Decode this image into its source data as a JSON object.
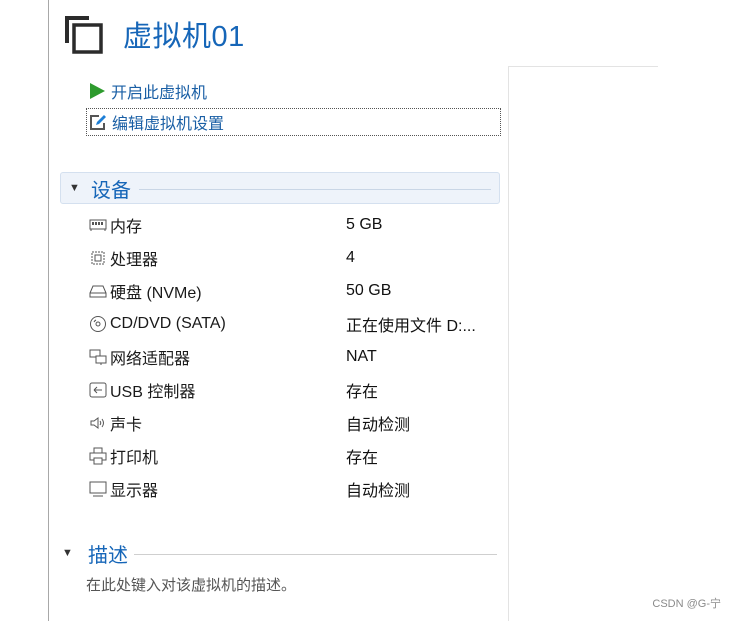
{
  "vm": {
    "title": "虚拟机01"
  },
  "actions": {
    "start_label": "开启此虚拟机",
    "edit_label": "编辑虚拟机设置"
  },
  "devices_section": {
    "title": "设备",
    "items": [
      {
        "name": "内存",
        "value": "5 GB",
        "icon": "memory-icon"
      },
      {
        "name": "处理器",
        "value": "4",
        "icon": "processor-icon"
      },
      {
        "name": "硬盘 (NVMe)",
        "value": "50 GB",
        "icon": "hard-disk-icon"
      },
      {
        "name": "CD/DVD (SATA)",
        "value": "正在使用文件 D:...",
        "icon": "cd-dvd-icon"
      },
      {
        "name": "网络适配器",
        "value": "NAT",
        "icon": "network-adapter-icon"
      },
      {
        "name": "USB 控制器",
        "value": "存在",
        "icon": "usb-icon"
      },
      {
        "name": "声卡",
        "value": "自动检测",
        "icon": "speaker-icon"
      },
      {
        "name": "打印机",
        "value": "存在",
        "icon": "printer-icon"
      },
      {
        "name": "显示器",
        "value": "自动检测",
        "icon": "monitor-icon"
      }
    ]
  },
  "description_section": {
    "title": "描述",
    "placeholder": "在此处键入对该虚拟机的描述。"
  },
  "watermark": "CSDN @G-宁",
  "colors": {
    "accent": "#1666b8",
    "play_green": "#2e9b2e"
  }
}
